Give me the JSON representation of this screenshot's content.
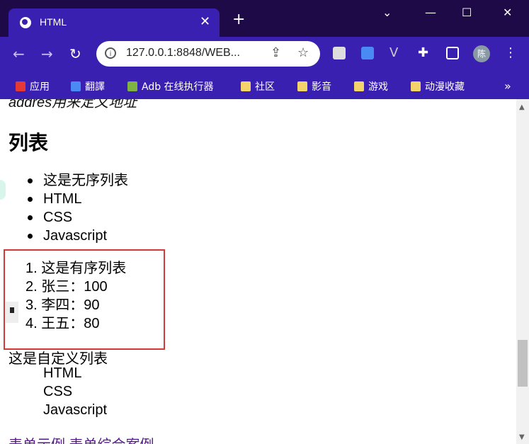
{
  "browser": {
    "tab_title": "HTML",
    "tab_close": "✕",
    "new_tab": "+",
    "window_controls": {
      "chevron": "⌄",
      "minimize": "—",
      "maximize": "☐",
      "close": "✕"
    },
    "url": "127.0.0.1:8848/WEB...",
    "avatar_text": "陈",
    "bookmarks": [
      "应用",
      "翻譯",
      "Adb 在线执行器",
      "社区",
      "影音",
      "游戏",
      "动漫收藏"
    ],
    "bookmarks_more": "»",
    "icons": [
      "globe-icon",
      "back-icon",
      "forward-icon",
      "reload-icon",
      "lock-icon",
      "share-icon",
      "star-icon",
      "extension-icon",
      "puzzle-icon",
      "sidepanel-icon",
      "menu-icon",
      "apps-icon",
      "translate-icon",
      "android-icon",
      "folder-icon"
    ]
  },
  "page": {
    "cut_text": "addres用来定义地址",
    "heading": "列表",
    "unordered": [
      "这是无序列表",
      "HTML",
      "CSS",
      "Javascript"
    ],
    "ordered": [
      "1. 这是有序列表",
      "2. 张三：100",
      "3. 李四：90",
      "4. 王五：80"
    ],
    "definition_title": "这是自定义列表",
    "definitions": [
      "HTML",
      "CSS",
      "Javascript"
    ],
    "links": "表单示例 表单综合案例",
    "highlight_color": "#d23a3a"
  }
}
